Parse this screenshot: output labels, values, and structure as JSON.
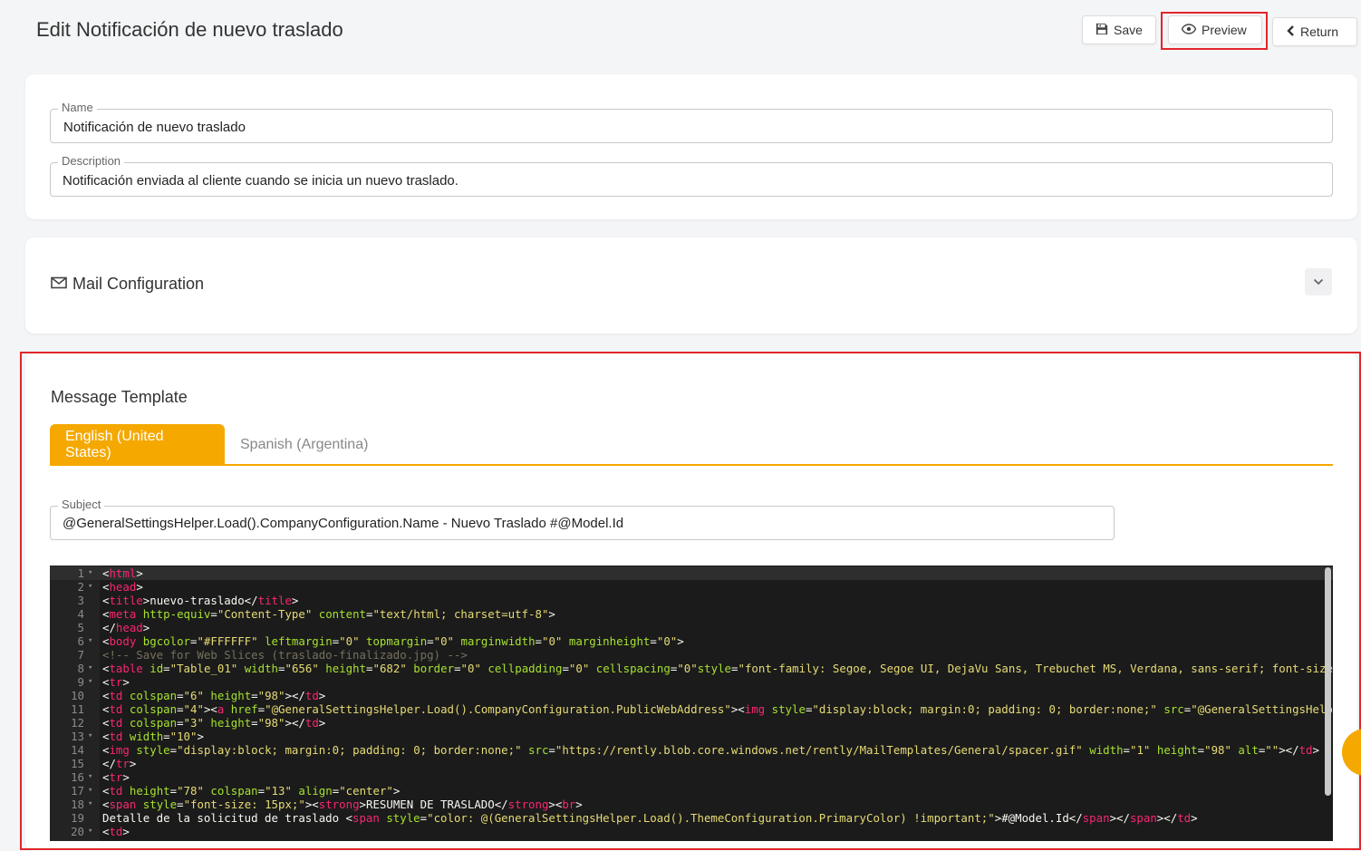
{
  "header": {
    "title": "Edit Notificación de nuevo traslado",
    "save_label": "Save",
    "preview_label": "Preview",
    "return_label": "Return"
  },
  "info": {
    "name_label": "Name",
    "name_value": "Notificación de nuevo traslado",
    "description_label": "Description",
    "description_value": "Notificación enviada al cliente cuando se inicia un nuevo traslado."
  },
  "mail": {
    "title": "Mail Configuration"
  },
  "template": {
    "title": "Message Template",
    "tabs": [
      {
        "label": "English (United States)",
        "active": true
      },
      {
        "label": "Spanish (Argentina)",
        "active": false
      }
    ],
    "subject_label": "Subject",
    "subject_value": "@GeneralSettingsHelper.Load().CompanyConfiguration.Name - Nuevo Traslado #@Model.Id"
  },
  "colors": {
    "accent": "#f5a800",
    "highlight_outline": "#e0262b",
    "editor_bg": "#1b1b1b"
  },
  "icons": {
    "save": "floppy-disk-icon",
    "preview": "eye-icon",
    "return": "chevron-left-icon",
    "mail": "envelope-icon",
    "collapse": "chevron-down-icon"
  },
  "code": [
    {
      "n": "1",
      "fold": true,
      "active": true,
      "tokens": [
        [
          "t",
          "<"
        ],
        [
          "tag",
          "html"
        ],
        [
          "t",
          ">"
        ]
      ]
    },
    {
      "n": "2",
      "fold": true,
      "tokens": [
        [
          "t",
          "<"
        ],
        [
          "tag",
          "head"
        ],
        [
          "t",
          ">"
        ]
      ]
    },
    {
      "n": "3",
      "fold": false,
      "tokens": [
        [
          "t",
          "<"
        ],
        [
          "tag",
          "title"
        ],
        [
          "t",
          ">nuevo-traslado</"
        ],
        [
          "tag",
          "title"
        ],
        [
          "t",
          ">"
        ]
      ]
    },
    {
      "n": "4",
      "fold": false,
      "tokens": [
        [
          "t",
          "<"
        ],
        [
          "tag",
          "meta"
        ],
        [
          "t",
          " "
        ],
        [
          "attr",
          "http-equiv"
        ],
        [
          "t",
          "="
        ],
        [
          "str",
          "\"Content-Type\""
        ],
        [
          "t",
          " "
        ],
        [
          "attr",
          "content"
        ],
        [
          "t",
          "="
        ],
        [
          "str",
          "\"text/html; charset=utf-8\""
        ],
        [
          "t",
          ">"
        ]
      ]
    },
    {
      "n": "5",
      "fold": false,
      "tokens": [
        [
          "t",
          "</"
        ],
        [
          "tag",
          "head"
        ],
        [
          "t",
          ">"
        ]
      ]
    },
    {
      "n": "6",
      "fold": true,
      "tokens": [
        [
          "t",
          "<"
        ],
        [
          "tag",
          "body"
        ],
        [
          "t",
          " "
        ],
        [
          "attr",
          "bgcolor"
        ],
        [
          "t",
          "="
        ],
        [
          "str",
          "\"#FFFFFF\""
        ],
        [
          "t",
          " "
        ],
        [
          "attr",
          "leftmargin"
        ],
        [
          "t",
          "="
        ],
        [
          "str",
          "\"0\""
        ],
        [
          "t",
          " "
        ],
        [
          "attr",
          "topmargin"
        ],
        [
          "t",
          "="
        ],
        [
          "str",
          "\"0\""
        ],
        [
          "t",
          " "
        ],
        [
          "attr",
          "marginwidth"
        ],
        [
          "t",
          "="
        ],
        [
          "str",
          "\"0\""
        ],
        [
          "t",
          " "
        ],
        [
          "attr",
          "marginheight"
        ],
        [
          "t",
          "="
        ],
        [
          "str",
          "\"0\""
        ],
        [
          "t",
          ">"
        ]
      ]
    },
    {
      "n": "7",
      "fold": false,
      "tokens": [
        [
          "cmt",
          "<!-- Save for Web Slices (traslado-finalizado.jpg) -->"
        ]
      ]
    },
    {
      "n": "8",
      "fold": true,
      "tokens": [
        [
          "t",
          "<"
        ],
        [
          "tag",
          "table"
        ],
        [
          "t",
          " "
        ],
        [
          "attr",
          "id"
        ],
        [
          "t",
          "="
        ],
        [
          "str",
          "\"Table_01\""
        ],
        [
          "t",
          " "
        ],
        [
          "attr",
          "width"
        ],
        [
          "t",
          "="
        ],
        [
          "str",
          "\"656\""
        ],
        [
          "t",
          " "
        ],
        [
          "attr",
          "height"
        ],
        [
          "t",
          "="
        ],
        [
          "str",
          "\"682\""
        ],
        [
          "t",
          " "
        ],
        [
          "attr",
          "border"
        ],
        [
          "t",
          "="
        ],
        [
          "str",
          "\"0\""
        ],
        [
          "t",
          " "
        ],
        [
          "attr",
          "cellpadding"
        ],
        [
          "t",
          "="
        ],
        [
          "str",
          "\"0\""
        ],
        [
          "t",
          " "
        ],
        [
          "attr",
          "cellspacing"
        ],
        [
          "t",
          "="
        ],
        [
          "str",
          "\"0\""
        ],
        [
          "attr",
          "style"
        ],
        [
          "t",
          "="
        ],
        [
          "str",
          "\"font-family: Segoe, Segoe UI, DejaVu Sans, Trebuchet MS, Verdana, sans-serif; font-size"
        ]
      ]
    },
    {
      "n": "9",
      "fold": true,
      "tokens": [
        [
          "t",
          "<"
        ],
        [
          "tag",
          "tr"
        ],
        [
          "t",
          ">"
        ]
      ]
    },
    {
      "n": "10",
      "fold": false,
      "tokens": [
        [
          "t",
          "<"
        ],
        [
          "tag",
          "td"
        ],
        [
          "t",
          " "
        ],
        [
          "attr",
          "colspan"
        ],
        [
          "t",
          "="
        ],
        [
          "str",
          "\"6\""
        ],
        [
          "t",
          " "
        ],
        [
          "attr",
          "height"
        ],
        [
          "t",
          "="
        ],
        [
          "str",
          "\"98\""
        ],
        [
          "t",
          "></"
        ],
        [
          "tag",
          "td"
        ],
        [
          "t",
          ">"
        ]
      ]
    },
    {
      "n": "11",
      "fold": false,
      "tokens": [
        [
          "t",
          "<"
        ],
        [
          "tag",
          "td"
        ],
        [
          "t",
          " "
        ],
        [
          "attr",
          "colspan"
        ],
        [
          "t",
          "="
        ],
        [
          "str",
          "\"4\""
        ],
        [
          "t",
          "><"
        ],
        [
          "tag",
          "a"
        ],
        [
          "t",
          " "
        ],
        [
          "attr",
          "href"
        ],
        [
          "t",
          "="
        ],
        [
          "str",
          "\"@GeneralSettingsHelper.Load().CompanyConfiguration.PublicWebAddress\""
        ],
        [
          "t",
          "><"
        ],
        [
          "tag",
          "img"
        ],
        [
          "t",
          " "
        ],
        [
          "attr",
          "style"
        ],
        [
          "t",
          "="
        ],
        [
          "str",
          "\"display:block; margin:0; padding: 0; border:none;\""
        ],
        [
          "t",
          " "
        ],
        [
          "attr",
          "src"
        ],
        [
          "t",
          "="
        ],
        [
          "str",
          "\"@GeneralSettingsHelp"
        ]
      ]
    },
    {
      "n": "12",
      "fold": false,
      "tokens": [
        [
          "t",
          "<"
        ],
        [
          "tag",
          "td"
        ],
        [
          "t",
          " "
        ],
        [
          "attr",
          "colspan"
        ],
        [
          "t",
          "="
        ],
        [
          "str",
          "\"3\""
        ],
        [
          "t",
          " "
        ],
        [
          "attr",
          "height"
        ],
        [
          "t",
          "="
        ],
        [
          "str",
          "\"98\""
        ],
        [
          "t",
          "></"
        ],
        [
          "tag",
          "td"
        ],
        [
          "t",
          ">"
        ]
      ]
    },
    {
      "n": "13",
      "fold": true,
      "tokens": [
        [
          "t",
          "<"
        ],
        [
          "tag",
          "td"
        ],
        [
          "t",
          " "
        ],
        [
          "attr",
          "width"
        ],
        [
          "t",
          "="
        ],
        [
          "str",
          "\"10\""
        ],
        [
          "t",
          ">"
        ]
      ]
    },
    {
      "n": "14",
      "fold": false,
      "tokens": [
        [
          "t",
          "<"
        ],
        [
          "tag",
          "img"
        ],
        [
          "t",
          " "
        ],
        [
          "attr",
          "style"
        ],
        [
          "t",
          "="
        ],
        [
          "str",
          "\"display:block; margin:0; padding: 0; border:none;\""
        ],
        [
          "t",
          " "
        ],
        [
          "attr",
          "src"
        ],
        [
          "t",
          "="
        ],
        [
          "str",
          "\"https://rently.blob.core.windows.net/rently/MailTemplates/General/spacer.gif\""
        ],
        [
          "t",
          " "
        ],
        [
          "attr",
          "width"
        ],
        [
          "t",
          "="
        ],
        [
          "str",
          "\"1\""
        ],
        [
          "t",
          " "
        ],
        [
          "attr",
          "height"
        ],
        [
          "t",
          "="
        ],
        [
          "str",
          "\"98\""
        ],
        [
          "t",
          " "
        ],
        [
          "attr",
          "alt"
        ],
        [
          "t",
          "="
        ],
        [
          "str",
          "\"\""
        ],
        [
          "t",
          "></"
        ],
        [
          "tag",
          "td"
        ],
        [
          "t",
          ">"
        ]
      ]
    },
    {
      "n": "15",
      "fold": false,
      "tokens": [
        [
          "t",
          "</"
        ],
        [
          "tag",
          "tr"
        ],
        [
          "t",
          ">"
        ]
      ]
    },
    {
      "n": "16",
      "fold": true,
      "tokens": [
        [
          "t",
          "<"
        ],
        [
          "tag",
          "tr"
        ],
        [
          "t",
          ">"
        ]
      ]
    },
    {
      "n": "17",
      "fold": true,
      "tokens": [
        [
          "t",
          "<"
        ],
        [
          "tag",
          "td"
        ],
        [
          "t",
          " "
        ],
        [
          "attr",
          "height"
        ],
        [
          "t",
          "="
        ],
        [
          "str",
          "\"78\""
        ],
        [
          "t",
          " "
        ],
        [
          "attr",
          "colspan"
        ],
        [
          "t",
          "="
        ],
        [
          "str",
          "\"13\""
        ],
        [
          "t",
          " "
        ],
        [
          "attr",
          "align"
        ],
        [
          "t",
          "="
        ],
        [
          "str",
          "\"center\""
        ],
        [
          "t",
          ">"
        ]
      ]
    },
    {
      "n": "18",
      "fold": true,
      "tokens": [
        [
          "t",
          "<"
        ],
        [
          "tag",
          "span"
        ],
        [
          "t",
          " "
        ],
        [
          "attr",
          "style"
        ],
        [
          "t",
          "="
        ],
        [
          "str",
          "\"font-size: 15px;\""
        ],
        [
          "t",
          "><"
        ],
        [
          "tag",
          "strong"
        ],
        [
          "t",
          ">RESUMEN DE TRASLADO</"
        ],
        [
          "tag",
          "strong"
        ],
        [
          "t",
          "><"
        ],
        [
          "tag",
          "br"
        ],
        [
          "t",
          ">"
        ]
      ]
    },
    {
      "n": "19",
      "fold": false,
      "tokens": [
        [
          "t",
          "Detalle de la solicitud de traslado <"
        ],
        [
          "tag",
          "span"
        ],
        [
          "t",
          " "
        ],
        [
          "attr",
          "style"
        ],
        [
          "t",
          "="
        ],
        [
          "str",
          "\"color: @(GeneralSettingsHelper.Load().ThemeConfiguration.PrimaryColor) !important;\""
        ],
        [
          "t",
          ">#@Model.Id</"
        ],
        [
          "tag",
          "span"
        ],
        [
          "t",
          "></"
        ],
        [
          "tag",
          "span"
        ],
        [
          "t",
          "></"
        ],
        [
          "tag",
          "td"
        ],
        [
          "t",
          ">"
        ]
      ]
    },
    {
      "n": "20",
      "fold": true,
      "tokens": [
        [
          "t",
          "<"
        ],
        [
          "tag",
          "td"
        ],
        [
          "t",
          ">"
        ]
      ]
    }
  ]
}
